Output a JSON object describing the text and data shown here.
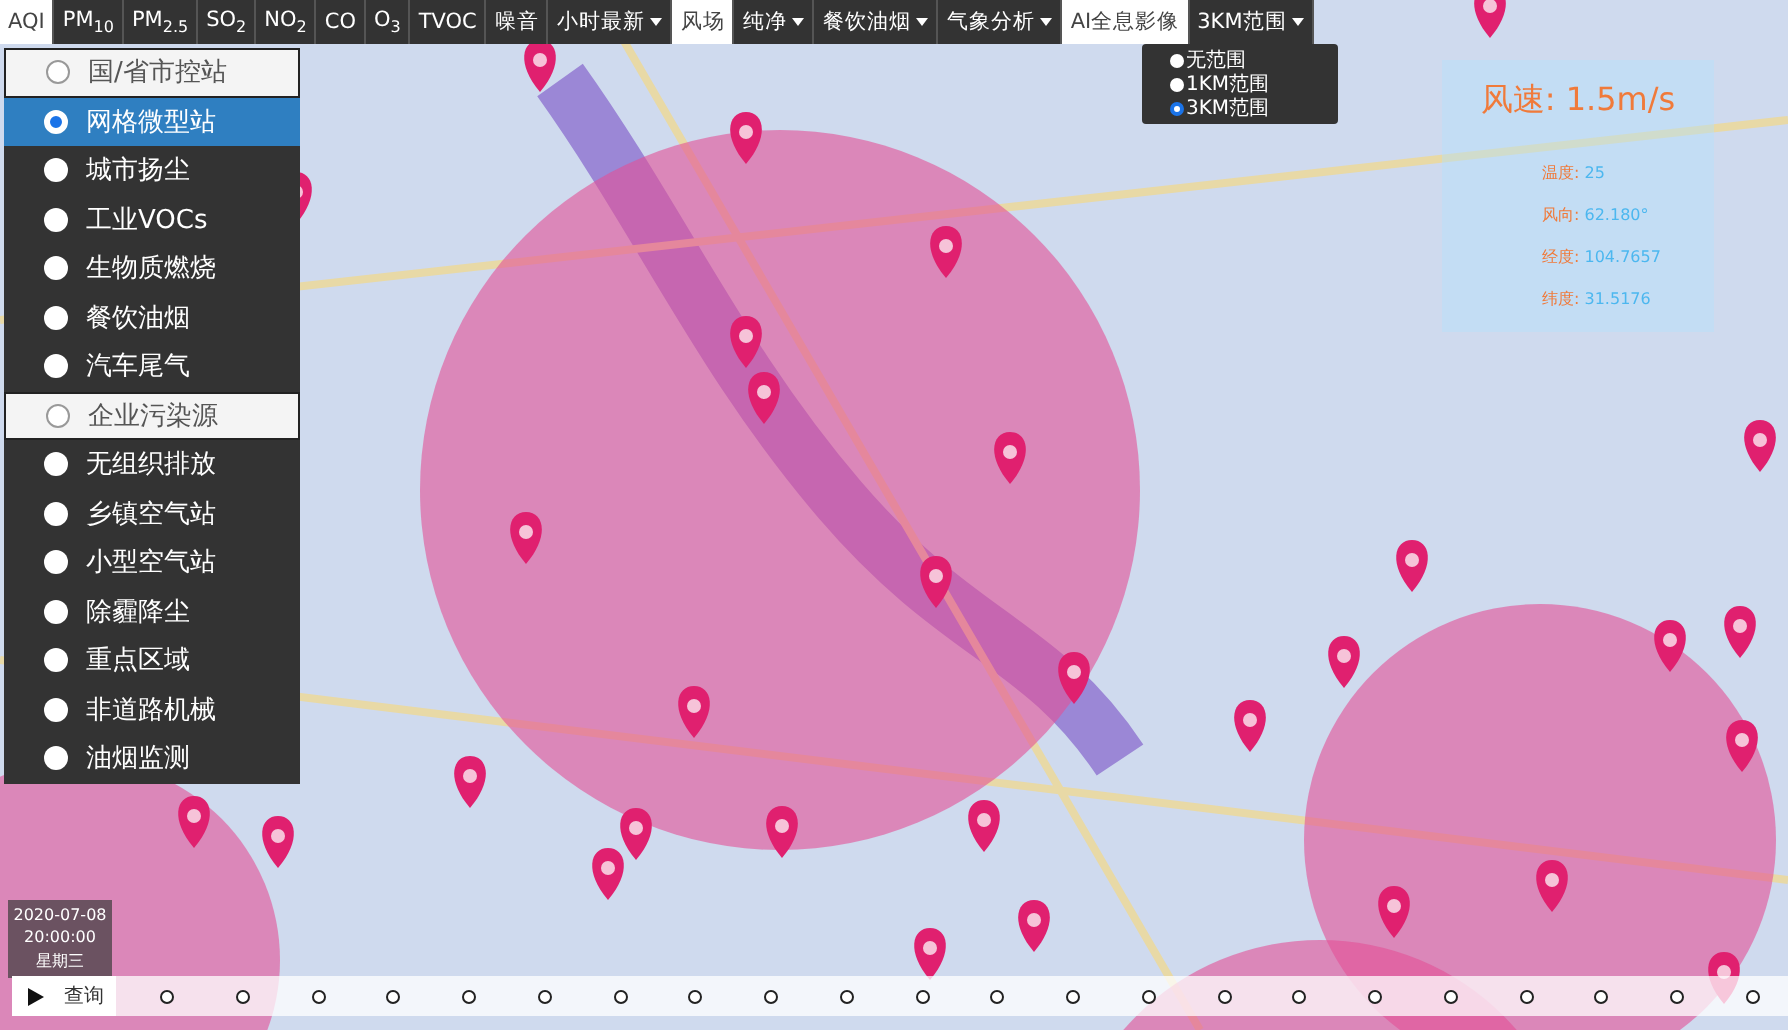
{
  "toolbar": [
    {
      "label": "AQI",
      "selected": true,
      "dropdown": false
    },
    {
      "label": "PM$_{10}$",
      "selected": false,
      "dropdown": false
    },
    {
      "label": "PM$_{2.5}$",
      "selected": false,
      "dropdown": false
    },
    {
      "label": "SO$_{2}$",
      "selected": false,
      "dropdown": false
    },
    {
      "label": "NO$_{2}$",
      "selected": false,
      "dropdown": false
    },
    {
      "label": "CO",
      "selected": false,
      "dropdown": false
    },
    {
      "label": "O$_{3}$",
      "selected": false,
      "dropdown": false
    },
    {
      "label": "TVOC",
      "selected": false,
      "dropdown": false
    },
    {
      "label": "噪音",
      "selected": false,
      "dropdown": false
    },
    {
      "label": "小时最新",
      "selected": false,
      "dropdown": true
    },
    {
      "label": "风场",
      "selected": true,
      "dropdown": false
    },
    {
      "label": "纯净",
      "selected": false,
      "dropdown": true
    },
    {
      "label": "餐饮油烟",
      "selected": false,
      "dropdown": true
    },
    {
      "label": "气象分析",
      "selected": false,
      "dropdown": true
    },
    {
      "label": "AI全息影像",
      "selected": true,
      "dropdown": false
    },
    {
      "label": "3KM范围",
      "selected": false,
      "dropdown": true
    }
  ],
  "range_menu": [
    {
      "label": "无范围",
      "selected": false
    },
    {
      "label": "1KM范围",
      "selected": false
    },
    {
      "label": "3KM范围",
      "selected": true
    }
  ],
  "station_list": [
    {
      "label": "国/省市控站",
      "kind": "group",
      "selected": false
    },
    {
      "label": "网格微型站",
      "kind": "item",
      "selected": true
    },
    {
      "label": "城市扬尘",
      "kind": "item",
      "selected": false
    },
    {
      "label": "工业VOCs",
      "kind": "item",
      "selected": false
    },
    {
      "label": "生物质燃烧",
      "kind": "item",
      "selected": false
    },
    {
      "label": "餐饮油烟",
      "kind": "item",
      "selected": false
    },
    {
      "label": "汽车尾气",
      "kind": "item",
      "selected": false
    },
    {
      "label": "企业污染源",
      "kind": "group",
      "selected": false
    },
    {
      "label": "无组织排放",
      "kind": "item",
      "selected": false
    },
    {
      "label": "乡镇空气站",
      "kind": "item",
      "selected": false
    },
    {
      "label": "小型空气站",
      "kind": "item",
      "selected": false
    },
    {
      "label": "除霾降尘",
      "kind": "item",
      "selected": false
    },
    {
      "label": "重点区域",
      "kind": "item",
      "selected": false
    },
    {
      "label": "非道路机械",
      "kind": "item",
      "selected": false
    },
    {
      "label": "油烟监测",
      "kind": "item",
      "selected": false
    }
  ],
  "weather_panel": {
    "wind_speed": "风速: 1.5m/s",
    "details": [
      {
        "label": "温度:",
        "value": "25"
      },
      {
        "label": "风向:",
        "value": "62.180°"
      },
      {
        "label": "经度:",
        "value": "104.7657"
      },
      {
        "label": "纬度:",
        "value": "31.5176"
      }
    ]
  },
  "timeline": {
    "date": "2020-07-08",
    "time": "20:00:00",
    "weekday": "星期三",
    "query_button": "查询"
  }
}
